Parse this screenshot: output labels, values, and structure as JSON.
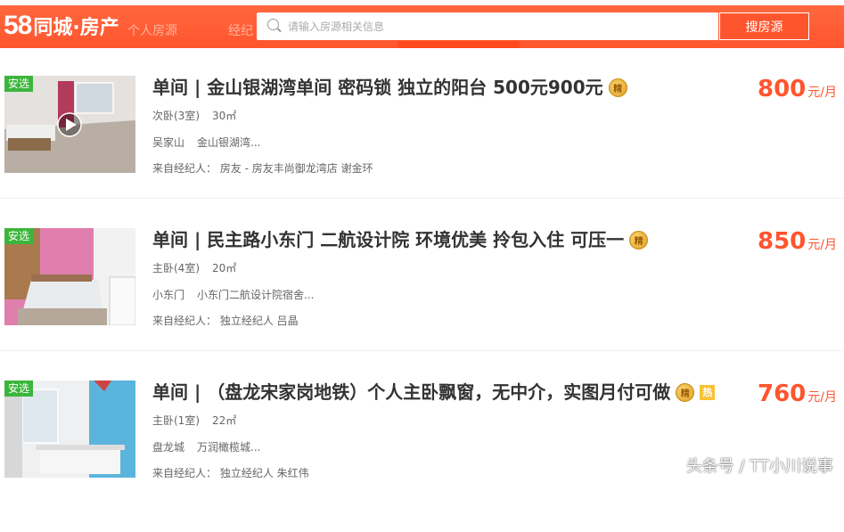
{
  "header": {
    "logo_number": "58",
    "logo_text": "同城·房产",
    "faded_nav_1": "个人房源",
    "faded_nav_2": "经纪",
    "search_placeholder": "请输入房源相关信息",
    "search_button": "搜房源",
    "brand_color": "#ff552e"
  },
  "listings": [
    {
      "badge": "安选",
      "title": "单间 | 金山银湖湾单间 密码锁 独立的阳台 500元900元",
      "medal": "精",
      "room_type": "次卧(3室)",
      "area": "30㎡",
      "district": "吴家山",
      "community": "金山银湖湾...",
      "agent": "来自经纪人： 房友 - 房友丰尚御龙湾店 谢金环",
      "price": "800",
      "price_unit": "元/月",
      "has_video": true
    },
    {
      "badge": "安选",
      "title": "单间 | 民主路小东门 二航设计院 环境优美 拎包入住 可压一",
      "medal": "精",
      "room_type": "主卧(4室)",
      "area": "20㎡",
      "district": "小东门",
      "community": "小东门二航设计院宿舍...",
      "agent": "来自经纪人： 独立经纪人 吕晶",
      "price": "850",
      "price_unit": "元/月"
    },
    {
      "badge": "安选",
      "title": "单间 | （盘龙宋家岗地铁）个人主卧飘窗，无中介，实图月付可做",
      "medal": "精",
      "hot": "热",
      "room_type": "主卧(1室)",
      "area": "22㎡",
      "district": "盘龙城",
      "community": "万润橄榄城...",
      "agent": "来自经纪人： 独立经纪人 朱红伟",
      "price": "760",
      "price_unit": "元/月"
    }
  ],
  "watermark": "头条号 / TT小川说事"
}
